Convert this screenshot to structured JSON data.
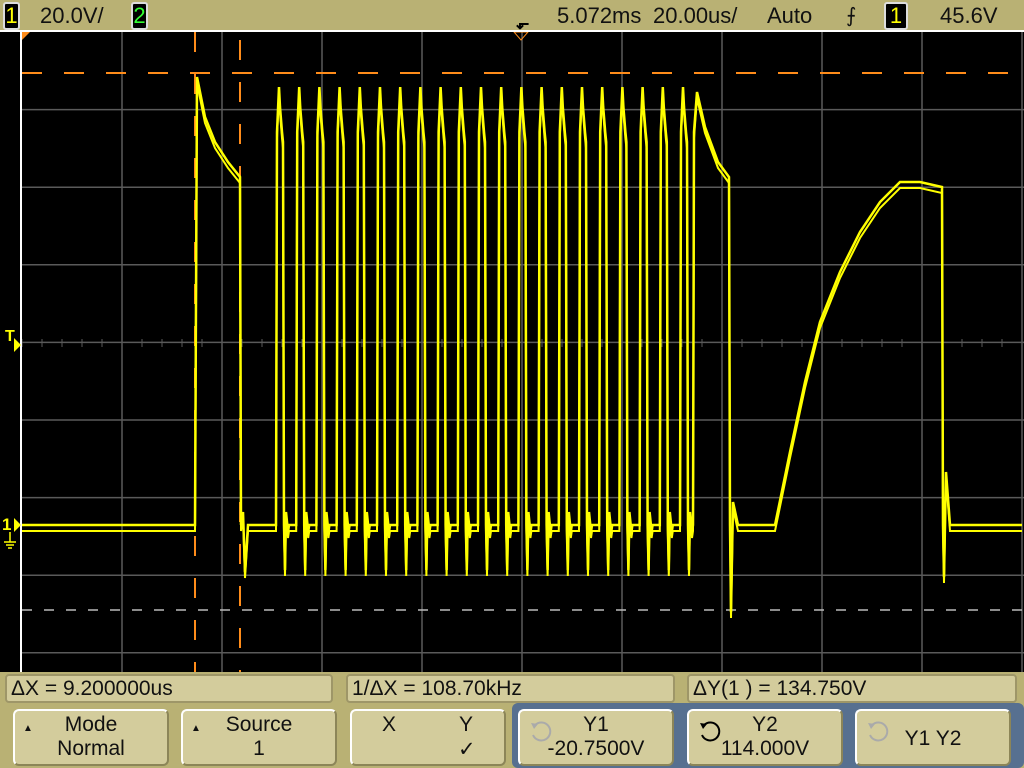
{
  "header": {
    "ch1_label": "1",
    "ch1_scale": "20.0V/",
    "ch2_label": "2",
    "time_delay": "5.072ms",
    "time_scale": "20.00us/",
    "trigger_mode": "Auto",
    "trigger_slope_icon": "rising-edge-icon",
    "trigger_source": "1",
    "trigger_level": "45.6V"
  },
  "markers": {
    "trigger": "T",
    "ch1_ground": "1"
  },
  "measurements": {
    "delta_x": "ΔX = 9.200000us",
    "inv_delta_x": "1/ΔX = 108.70kHz",
    "delta_y": "ΔY(1 ) = 134.750V"
  },
  "softkeys": [
    {
      "title": "Mode",
      "value": "Normal"
    },
    {
      "title": "Source",
      "value": "1"
    },
    {
      "title_x": "X",
      "title_y": "Y",
      "check": "✓"
    },
    {
      "title": "Y1",
      "value": "-20.7500V"
    },
    {
      "title": "Y2",
      "value": "114.000V"
    },
    {
      "title": "Y1 Y2"
    }
  ],
  "colors": {
    "trace": "#ffff00",
    "cursor": "#ff8c1a",
    "grid": "#5a5a5a",
    "header": "#b9b174",
    "softkey": "#d3cc9c",
    "selected_group": "#577090"
  }
}
